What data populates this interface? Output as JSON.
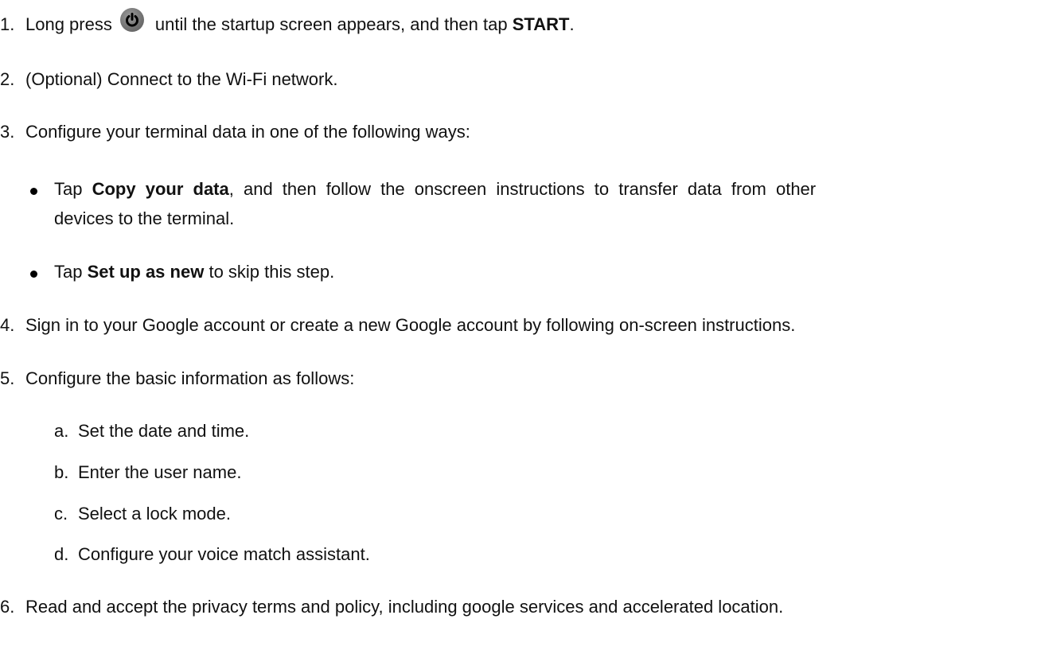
{
  "steps": {
    "s1": {
      "num": "1.",
      "pre": "Long press",
      "post": "until the startup screen appears, and then tap",
      "bold": "START",
      "end": "."
    },
    "s2": {
      "num": "2.",
      "text": "(Optional) Connect to the Wi-Fi network."
    },
    "s3": {
      "num": "3.",
      "text": "Configure your terminal data in one of the following ways:"
    },
    "s3_b1": {
      "pre": "Tap",
      "bold": "Copy your data",
      "post": ", and then follow the onscreen instructions to transfer data from other",
      "line2": "devices to the terminal."
    },
    "s3_b2": {
      "pre": "Tap",
      "bold": "Set up as new",
      "post": "to skip this step."
    },
    "s4": {
      "num": "4.",
      "text": "Sign in to your Google account or create a new Google account by following on-screen instructions."
    },
    "s5": {
      "num": "5.",
      "text": "Configure the basic information as follows:"
    },
    "s5_a": {
      "label": "a.",
      "text": "Set the date and time."
    },
    "s5_b": {
      "label": "b.",
      "text": "Enter the user name."
    },
    "s5_c": {
      "label": "c.",
      "text": "Select a lock mode."
    },
    "s5_d": {
      "label": "d.",
      "text": "Configure your voice match assistant."
    },
    "s6": {
      "num": "6.",
      "text": "Read and accept the privacy terms and policy, including google services and accelerated location."
    }
  },
  "icons": {
    "power": "power-icon"
  }
}
